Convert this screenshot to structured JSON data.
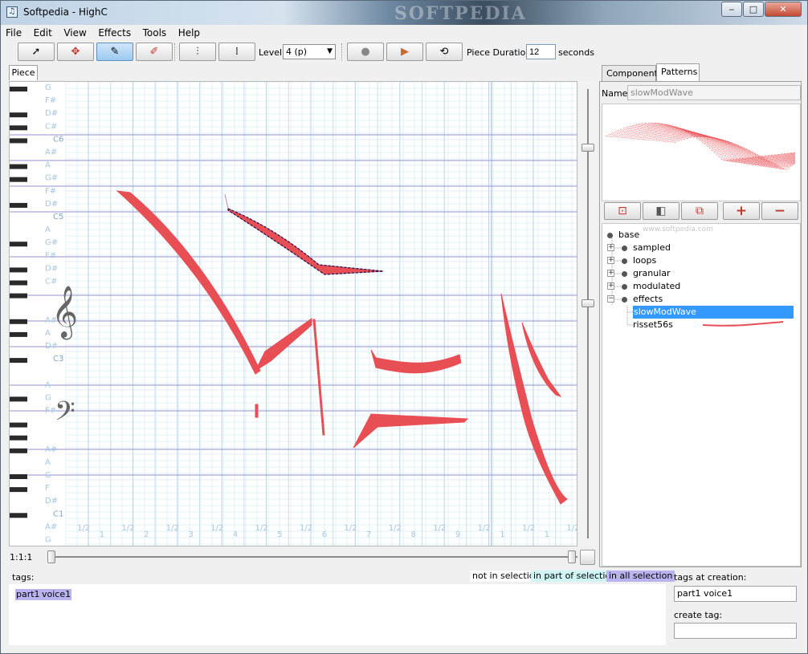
{
  "window": {
    "title": "Softpedia - HighC",
    "brand_watermark": "SOFTPEDIA",
    "controls": {
      "minimize": "‒",
      "maximize": "□",
      "close": "✕"
    }
  },
  "menu": [
    "File",
    "Edit",
    "View",
    "Effects",
    "Tools",
    "Help"
  ],
  "toolbar": {
    "tools": [
      {
        "name": "select-tool",
        "icon": "arrow-cursor-icon",
        "glyph": "➚"
      },
      {
        "name": "multi-select-tool",
        "icon": "select-plus-icon",
        "glyph": "✥"
      },
      {
        "name": "draw-tool",
        "icon": "pen-icon",
        "glyph": "✎"
      },
      {
        "name": "edit-tool",
        "icon": "pencil-edit-icon",
        "glyph": "✐"
      }
    ],
    "align_tools": [
      {
        "name": "align-tool",
        "icon": "align-icon",
        "glyph": "⫶"
      },
      {
        "name": "grid-tool",
        "icon": "grid-icon",
        "glyph": "⁞"
      }
    ],
    "level_label": "Level:",
    "level_value": "4 (p)",
    "transport": [
      {
        "name": "record-button",
        "icon": "record-icon",
        "glyph": "●"
      },
      {
        "name": "play-button",
        "icon": "play-icon",
        "glyph": "▶"
      },
      {
        "name": "loop-button",
        "icon": "loop-icon",
        "glyph": "⟲"
      }
    ],
    "duration_label": "Piece Duration:",
    "duration_value": "12",
    "seconds_label": "seconds"
  },
  "piece_tab": "Piece",
  "piano_roll": {
    "note_labels": [
      {
        "text": "G",
        "row": 0
      },
      {
        "text": "F#",
        "row": 1
      },
      {
        "text": "D#",
        "row": 2
      },
      {
        "text": "C#",
        "row": 3
      },
      {
        "text": "C6",
        "row": 4
      },
      {
        "text": "A#",
        "row": 5
      },
      {
        "text": "A",
        "row": 6
      },
      {
        "text": "G#",
        "row": 7
      },
      {
        "text": "F#",
        "row": 8
      },
      {
        "text": "D#",
        "row": 9
      },
      {
        "text": "C5",
        "row": 10
      },
      {
        "text": "A",
        "row": 11
      },
      {
        "text": "G#",
        "row": 12
      },
      {
        "text": "F#",
        "row": 13
      },
      {
        "text": "D#",
        "row": 14
      },
      {
        "text": "C#",
        "row": 15
      },
      {
        "text": "A#",
        "row": 18
      },
      {
        "text": "A",
        "row": 19
      },
      {
        "text": "D#",
        "row": 20
      },
      {
        "text": "C3",
        "row": 21
      },
      {
        "text": "A",
        "row": 23
      },
      {
        "text": "G",
        "row": 24
      },
      {
        "text": "F#",
        "row": 25
      },
      {
        "text": "A#",
        "row": 28
      },
      {
        "text": "A",
        "row": 29
      },
      {
        "text": "G",
        "row": 30
      },
      {
        "text": "F",
        "row": 31
      },
      {
        "text": "D#",
        "row": 32
      },
      {
        "text": "C1",
        "row": 33
      },
      {
        "text": "A#",
        "row": 34
      },
      {
        "text": "G",
        "row": 35
      }
    ],
    "beat_labels": [
      "1/2",
      "1",
      "1/2",
      "2",
      "1/2",
      "3",
      "1/2",
      "4",
      "1/2",
      "5",
      "1/2",
      "6",
      "1/2",
      "7",
      "1/2",
      "8",
      "1/2",
      "9",
      "1/2",
      "1",
      "1/2",
      "1",
      "1/2"
    ],
    "clef_treble": "𝄞",
    "clef_bass": "𝄢",
    "note_color": "#e84f55"
  },
  "zoom_label": "1:1:1",
  "right_panel": {
    "tabs": [
      "Components",
      "Patterns"
    ],
    "active_tab": "Patterns",
    "name_label": "Name:",
    "name_value": "slowModWave",
    "pattern_buttons": [
      {
        "name": "edit-pattern-button",
        "icon": "edit-pattern-icon",
        "glyph": "⊡"
      },
      {
        "name": "mute-pattern-button",
        "icon": "speaker-icon",
        "glyph": "◧"
      },
      {
        "name": "copy-pattern-button",
        "icon": "copy-icon",
        "glyph": "⧉"
      },
      {
        "name": "add-pattern-button",
        "icon": "plus-icon",
        "glyph": "+"
      },
      {
        "name": "remove-pattern-button",
        "icon": "minus-icon",
        "glyph": "−"
      }
    ],
    "tree_watermark": "www.softpedia.com",
    "tree": [
      {
        "label": "base",
        "depth": 0,
        "expander": ""
      },
      {
        "label": "sampled",
        "depth": 1,
        "expander": "+"
      },
      {
        "label": "loops",
        "depth": 1,
        "expander": "+"
      },
      {
        "label": "granular",
        "depth": 1,
        "expander": "+"
      },
      {
        "label": "modulated",
        "depth": 1,
        "expander": "+"
      },
      {
        "label": "effects",
        "depth": 1,
        "expander": "−"
      },
      {
        "label": "slowModWave",
        "depth": 2,
        "expander": "",
        "selected": true
      },
      {
        "label": "risset56s",
        "depth": 2,
        "expander": ""
      }
    ]
  },
  "bottom": {
    "tags_label": "tags:",
    "legend": [
      "not in selection",
      "in part of selection",
      "in all selection"
    ],
    "tags": [
      "part1",
      "voice1"
    ],
    "tags_at_creation_label": "tags at creation:",
    "tags_at_creation_value": "part1 voice1",
    "create_tag_label": "create tag:",
    "create_tag_value": ""
  },
  "colors": {
    "accent": "#3399ff",
    "note": "#e84f55",
    "tag_all": "#b9b4f0",
    "tag_part": "#cff5f5"
  }
}
